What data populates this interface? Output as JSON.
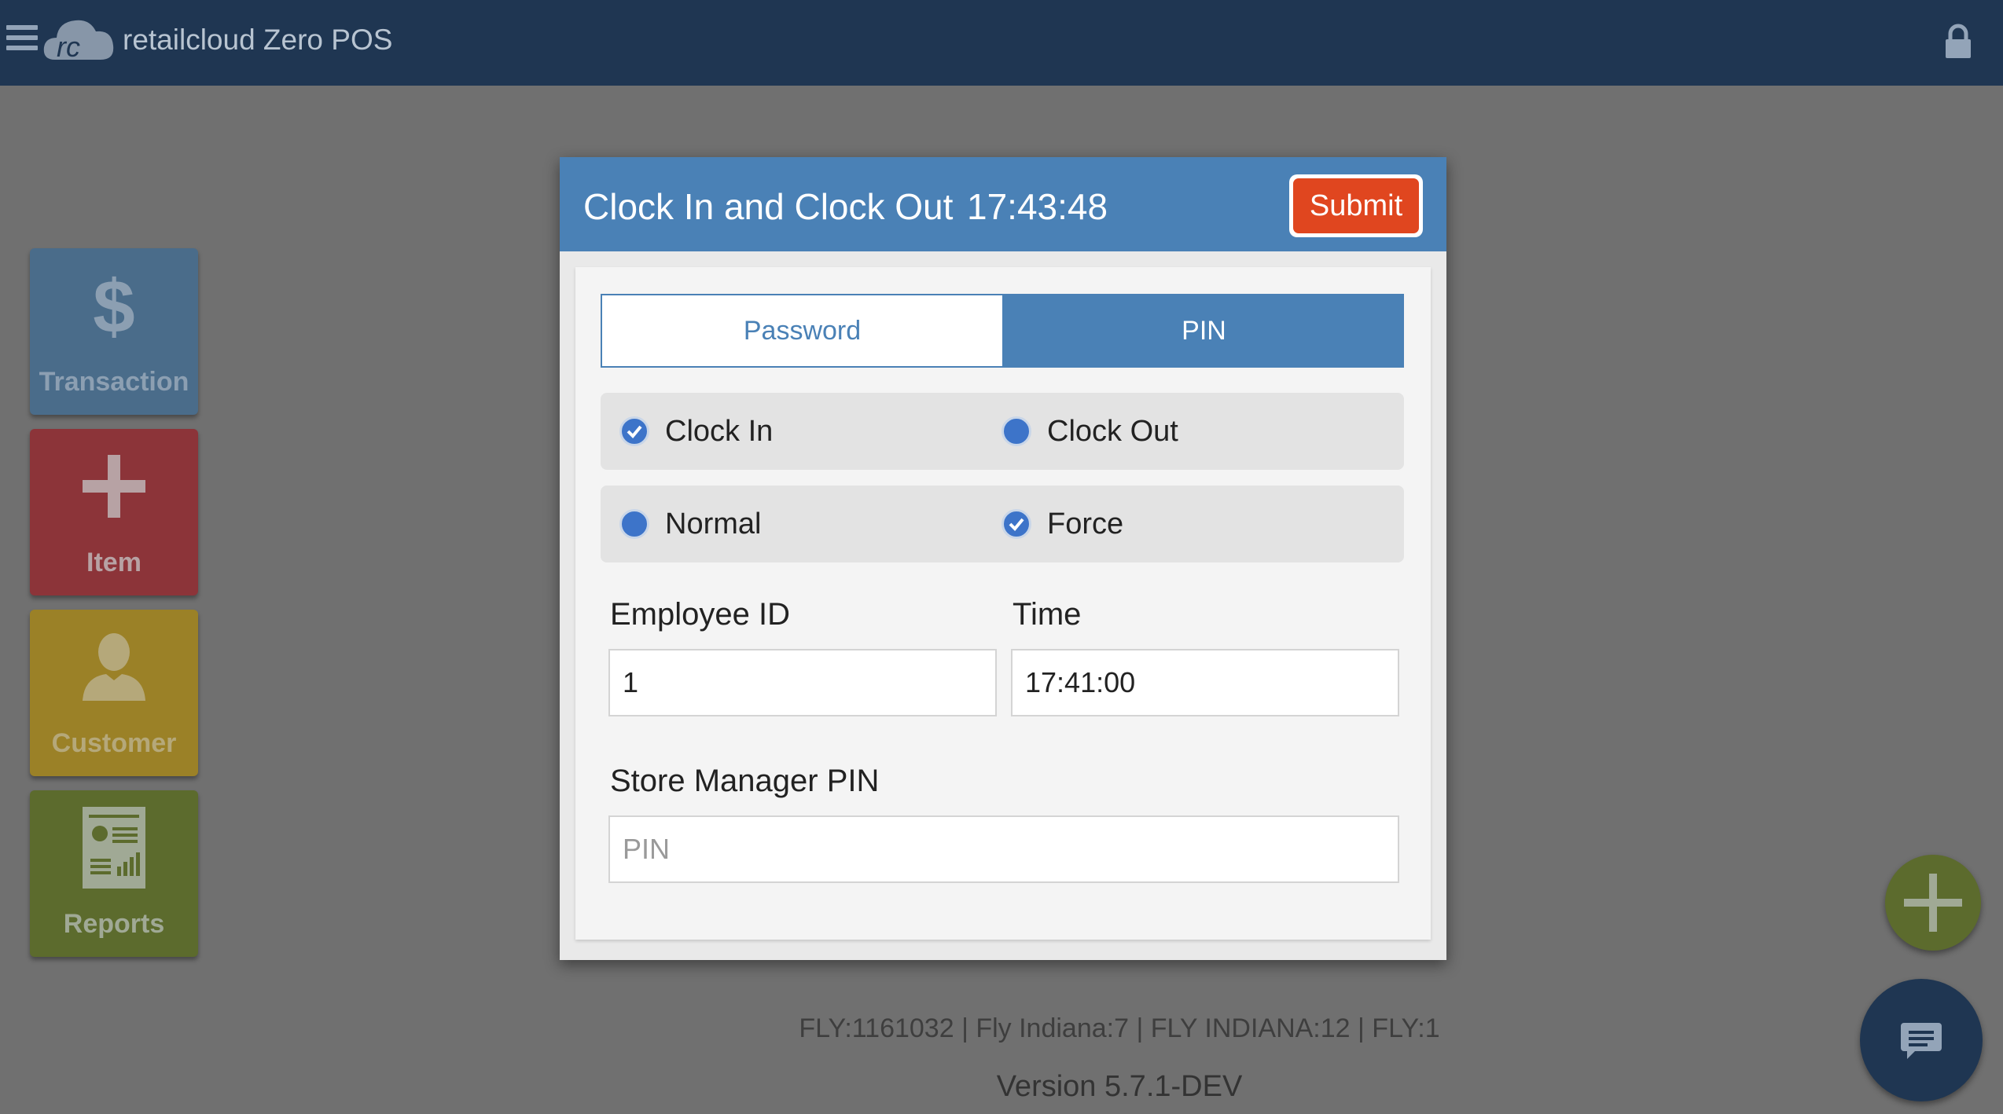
{
  "app": {
    "title": "retailcloud Zero POS"
  },
  "icons": {
    "menu": "hamburger-menu-icon",
    "logo": "rc-cloud-logo",
    "lock": "lock-icon",
    "transaction": "dollar-icon",
    "item": "plus-icon",
    "customer": "person-icon",
    "reports": "report-document-icon",
    "add_fab": "plus-icon",
    "chat_fab": "chat-bubble-icon"
  },
  "sidebar": {
    "tiles": [
      {
        "label": "Transaction",
        "color": "#4a6c8a"
      },
      {
        "label": "Item",
        "color": "#8c3439"
      },
      {
        "label": "Customer",
        "color": "#9b8127"
      },
      {
        "label": "Reports",
        "color": "#5c6b2d"
      }
    ]
  },
  "dialog": {
    "title": "Clock In and Clock Out",
    "clock": "17:43:48",
    "submit_label": "Submit",
    "tabs": [
      {
        "label": "Password",
        "selected": false
      },
      {
        "label": "PIN",
        "selected": true
      }
    ],
    "mode_options": [
      {
        "label": "Clock In",
        "checked": true
      },
      {
        "label": "Clock Out",
        "checked": false
      }
    ],
    "type_options": [
      {
        "label": "Normal",
        "checked": false
      },
      {
        "label": "Force",
        "checked": true
      }
    ],
    "employee_id": {
      "label": "Employee ID",
      "value": "1"
    },
    "time": {
      "label": "Time",
      "value": "17:41:00"
    },
    "manager_pin": {
      "label": "Store Manager PIN",
      "placeholder": "PIN",
      "value": ""
    }
  },
  "footer": {
    "store_info": "FLY:1161032 | Fly Indiana:7 | FLY INDIANA:12 | FLY:1",
    "version": "Version 5.7.1-DEV"
  },
  "colors": {
    "topbar": "#1f3652",
    "dialog_header": "#4a81b6",
    "submit": "#e0461f",
    "radio": "#3d74c9"
  }
}
